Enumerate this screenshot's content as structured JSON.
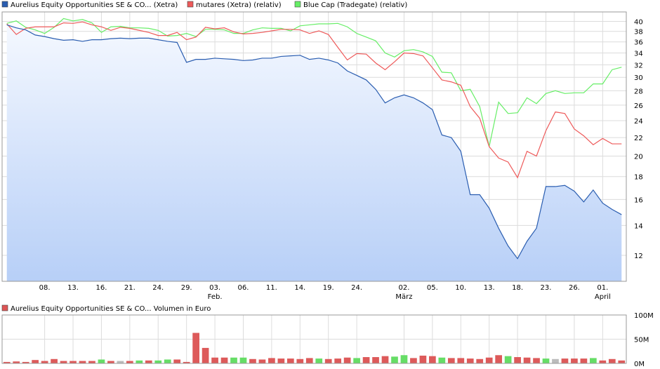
{
  "chart_data": [
    {
      "type": "area",
      "legend": "top",
      "grid": true,
      "y_scale": "log",
      "ylim": [
        10.5,
        42
      ],
      "y_ticks": [
        12,
        14,
        16,
        18,
        20,
        22,
        24,
        26,
        28,
        30,
        32,
        34,
        36,
        38,
        40
      ],
      "x_tick_labels": [
        "08.",
        "13.",
        "16.",
        "21.",
        "24.",
        "29.",
        "03.",
        "06.",
        "11.",
        "14.",
        "19.",
        "24.",
        "02.",
        "05.",
        "10.",
        "13.",
        "18.",
        "23.",
        "26.",
        "01."
      ],
      "x_tick_index": [
        4,
        7,
        10,
        13,
        16,
        19,
        22,
        25,
        28,
        31,
        34,
        37,
        42,
        45,
        48,
        51,
        54,
        57,
        60,
        63
      ],
      "month_labels": [
        {
          "label": "Feb.",
          "index": 22
        },
        {
          "label": "März",
          "index": 42
        },
        {
          "label": "April",
          "index": 63
        }
      ],
      "series": [
        {
          "name": "Aurelius Equity Opportunities SE & CO... (Xetra)",
          "color": "#2a5db0",
          "values": [
            39.3,
            38.7,
            38.3,
            37.3,
            37.0,
            36.6,
            36.3,
            36.4,
            36.1,
            36.4,
            36.4,
            36.6,
            36.7,
            36.6,
            36.7,
            36.7,
            36.4,
            36.1,
            35.9,
            32.4,
            32.9,
            32.9,
            33.1,
            33.0,
            32.9,
            32.7,
            32.8,
            33.1,
            33.1,
            33.4,
            33.5,
            33.6,
            32.9,
            33.1,
            32.8,
            32.3,
            31.0,
            30.3,
            29.6,
            28.2,
            26.3,
            27.0,
            27.4,
            27.0,
            26.3,
            25.4,
            22.3,
            22.0,
            20.5,
            16.4,
            16.4,
            15.3,
            13.8,
            12.6,
            11.8,
            12.9,
            13.8,
            17.1,
            17.1,
            17.2,
            16.7,
            15.8,
            16.8,
            15.7,
            15.2,
            14.8
          ]
        },
        {
          "name": "mutares (Xetra) (relativ)",
          "color": "#ee5a5a",
          "values": [
            39.5,
            37.4,
            38.6,
            38.9,
            38.9,
            38.9,
            39.7,
            39.6,
            39.9,
            39.3,
            38.9,
            38.2,
            38.8,
            38.6,
            38.2,
            37.8,
            37.2,
            37.2,
            37.8,
            36.4,
            36.9,
            38.8,
            38.5,
            38.7,
            37.9,
            37.5,
            37.6,
            37.8,
            38.1,
            38.4,
            38.4,
            38.3,
            37.6,
            38.1,
            37.4,
            35.0,
            32.8,
            33.9,
            33.8,
            32.3,
            31.2,
            32.5,
            34.0,
            33.9,
            33.5,
            31.5,
            29.6,
            29.3,
            28.8,
            25.8,
            24.3,
            21.0,
            19.8,
            19.4,
            17.9,
            20.5,
            20.0,
            22.8,
            25.1,
            24.9,
            23.0,
            22.2,
            21.2,
            21.9,
            21.3,
            21.3
          ]
        },
        {
          "name": "Blue Cap (Tradegate) (relativ)",
          "color": "#66ee66",
          "values": [
            39.6,
            40.1,
            38.8,
            38.3,
            37.6,
            38.8,
            40.6,
            40.1,
            40.4,
            39.7,
            37.8,
            38.9,
            39.0,
            38.7,
            38.7,
            38.6,
            38.2,
            37.1,
            37.2,
            37.6,
            37.0,
            38.4,
            38.4,
            38.3,
            37.6,
            37.6,
            38.3,
            38.7,
            38.6,
            38.6,
            38.1,
            39.1,
            39.3,
            39.5,
            39.5,
            39.6,
            38.9,
            37.6,
            36.9,
            36.2,
            34.0,
            33.3,
            34.4,
            34.6,
            34.2,
            33.4,
            30.8,
            30.7,
            28.0,
            28.2,
            25.8,
            21.0,
            26.4,
            24.9,
            25.0,
            27.0,
            26.2,
            27.6,
            28.0,
            27.6,
            27.7,
            27.7,
            29.0,
            29.0,
            31.2,
            31.6
          ]
        }
      ]
    },
    {
      "type": "bar",
      "title": "Aurelius Equity Opportunities SE & CO... Volumen in Euro",
      "legend_color": "#dd5555",
      "grid": true,
      "ylim": [
        0,
        100
      ],
      "y_tick_labels": [
        "0M",
        "50M",
        "100M"
      ],
      "y_tick_values": [
        0,
        50,
        100
      ],
      "colors": {
        "down": "#dd5a5a",
        "up": "#66dd66",
        "flat": "#bbbbbb"
      },
      "directions": [
        "down",
        "down",
        "down",
        "down",
        "down",
        "down",
        "down",
        "down",
        "down",
        "down",
        "up",
        "down",
        "flat",
        "down",
        "up",
        "down",
        "up",
        "up",
        "down",
        "down",
        "down",
        "down",
        "down",
        "down",
        "up",
        "up",
        "down",
        "down",
        "down",
        "down",
        "down",
        "down",
        "down",
        "up",
        "down",
        "down",
        "down",
        "up",
        "down",
        "down",
        "down",
        "up",
        "up",
        "down",
        "down",
        "down",
        "up",
        "down",
        "down",
        "down",
        "down",
        "down",
        "down",
        "up",
        "down",
        "down",
        "down",
        "up",
        "flat",
        "down",
        "down",
        "down",
        "up",
        "down",
        "down",
        "down"
      ],
      "values": [
        3,
        4,
        3,
        7,
        5,
        9,
        5,
        5,
        5,
        5,
        8,
        5,
        5,
        5,
        6,
        6,
        6,
        8,
        8,
        3,
        63,
        32,
        12,
        12,
        12,
        12,
        9,
        8,
        11,
        10,
        10,
        9,
        11,
        10,
        9,
        10,
        12,
        11,
        13,
        13,
        15,
        14,
        17,
        11,
        16,
        15,
        12,
        11,
        11,
        10,
        9,
        12,
        17,
        15,
        13,
        12,
        11,
        10,
        9,
        10,
        10,
        10,
        11,
        6,
        9,
        6
      ]
    }
  ]
}
